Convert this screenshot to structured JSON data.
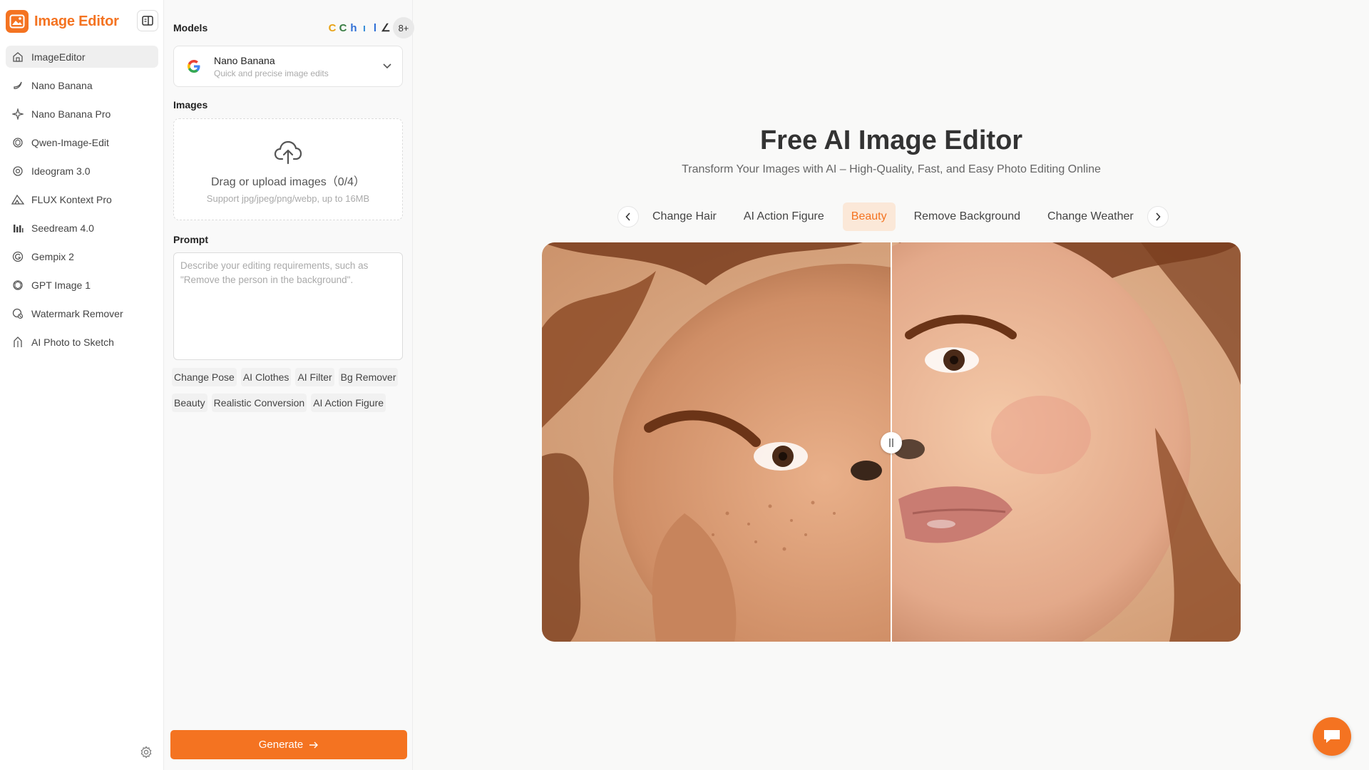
{
  "brand": {
    "name": "Image Editor"
  },
  "colors": {
    "accent": "#f47321",
    "activeTabBg": "#fbe8d8",
    "sidebarActive": "#efefef"
  },
  "sidebar": {
    "items": [
      {
        "label": "ImageEditor",
        "icon": "home-icon"
      },
      {
        "label": "Nano Banana",
        "icon": "banana-icon"
      },
      {
        "label": "Nano Banana Pro",
        "icon": "sparkle-icon"
      },
      {
        "label": "Qwen-Image-Edit",
        "icon": "qwen-icon"
      },
      {
        "label": "Ideogram 3.0",
        "icon": "ideogram-icon"
      },
      {
        "label": "FLUX Kontext Pro",
        "icon": "flux-icon"
      },
      {
        "label": "Seedream 4.0",
        "icon": "seedream-icon"
      },
      {
        "label": "Gempix 2",
        "icon": "gempix-icon"
      },
      {
        "label": "GPT Image 1",
        "icon": "openai-icon"
      },
      {
        "label": "Watermark Remover",
        "icon": "watermark-icon"
      },
      {
        "label": "AI Photo to Sketch",
        "icon": "sketch-icon"
      }
    ]
  },
  "panel": {
    "models_label": "Models",
    "more_models": "8+",
    "model": {
      "name": "Nano Banana",
      "description": "Quick and precise image edits"
    },
    "images_label": "Images",
    "upload": {
      "title": "Drag or upload images（0/4）",
      "subtitle": "Support jpg/jpeg/png/webp, up to 16MB"
    },
    "prompt_label": "Prompt",
    "prompt_placeholder": "Describe your editing requirements, such as \"Remove the person in the background\".",
    "chips": [
      "Change Pose",
      "AI Clothes",
      "AI Filter",
      "Bg Remover",
      "Beauty",
      "Realistic Conversion",
      "AI Action Figure"
    ],
    "generate_label": "Generate"
  },
  "hero": {
    "title": "Free AI Image Editor",
    "subtitle": "Transform Your Images with AI – High-Quality, Fast, and Easy Photo Editing Online"
  },
  "tabs": [
    {
      "label": "Change Hair",
      "active": false
    },
    {
      "label": "AI Action Figure",
      "active": false
    },
    {
      "label": "Beauty",
      "active": true
    },
    {
      "label": "Remove Background",
      "active": false
    },
    {
      "label": "Change Weather",
      "active": false
    }
  ]
}
